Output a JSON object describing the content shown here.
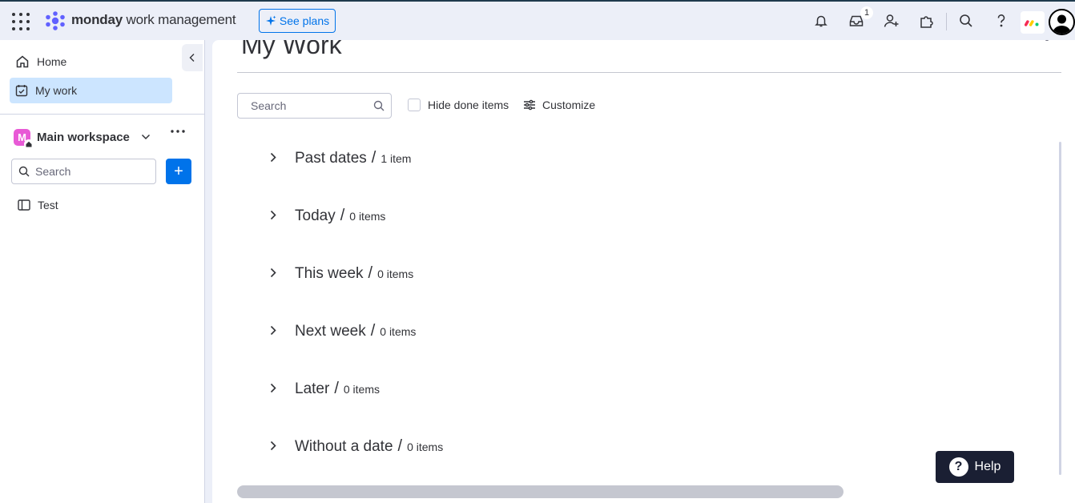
{
  "topbar": {
    "brand_bold": "monday",
    "brand_light": "work management",
    "see_plans": "See plans",
    "inbox_badge": "1",
    "icons": [
      "apps-grid-icon",
      "notifications-bell-icon",
      "inbox-icon",
      "invite-member-icon",
      "apps-marketplace-icon",
      "search-icon",
      "help-icon"
    ]
  },
  "sidebar": {
    "home": "Home",
    "my_work": "My work",
    "workspace_initial": "M",
    "workspace_name": "Main workspace",
    "search_placeholder": "Search",
    "add_label": "+",
    "boards": [
      {
        "label": "Test"
      }
    ]
  },
  "main": {
    "title": "My Work",
    "search_placeholder": "Search",
    "hide_done": "Hide done items",
    "customize": "Customize",
    "groups": [
      {
        "name": "Past dates",
        "count": "1 item"
      },
      {
        "name": "Today",
        "count": "0 items"
      },
      {
        "name": "This week",
        "count": "0 items"
      },
      {
        "name": "Next week",
        "count": "0 items"
      },
      {
        "name": "Later",
        "count": "0 items"
      },
      {
        "name": "Without a date",
        "count": "0 items"
      }
    ],
    "separator": "/",
    "help": "Help",
    "help_glyph": "?"
  },
  "colors": {
    "accent": "#0073ea",
    "active_nav": "#cce5ff",
    "workspace_icon": "#e85ad6",
    "help_button": "#1a1f33"
  }
}
